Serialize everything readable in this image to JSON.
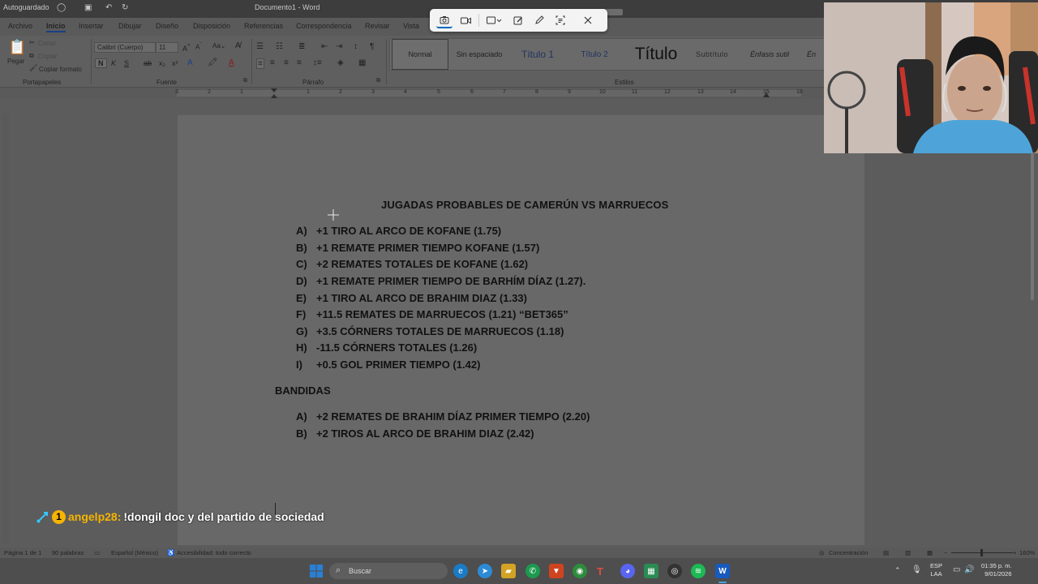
{
  "titlebar": {
    "autosave": "Autoguardado",
    "document_title": "Documento1 - Word"
  },
  "snip_toolbar": {
    "icons": [
      "camera-icon",
      "video-icon",
      "rect-select-icon",
      "edit-icon",
      "pen-icon",
      "text-extract-icon",
      "close-icon"
    ]
  },
  "menu": {
    "tabs": [
      "Archivo",
      "Inicio",
      "Insertar",
      "Dibujar",
      "Diseño",
      "Disposición",
      "Referencias",
      "Correspondencia",
      "Revisar",
      "Vista"
    ],
    "active_tab": "Inicio"
  },
  "ribbon": {
    "clipboard": {
      "paste_label": "Pegar",
      "cut_label": "Cortar",
      "copy_label": "Copiar",
      "format_painter_label": "Copiar formato",
      "group_label": "Portapapeles"
    },
    "font": {
      "font_name": "Calibri (Cuerpo)",
      "font_size": "11",
      "bold": "N",
      "italic": "K",
      "underline": "S",
      "group_label": "Fuente"
    },
    "paragraph": {
      "group_label": "Párrafo"
    },
    "styles": {
      "group_label": "Estilos",
      "items": [
        "Normal",
        "Sin espaciado",
        "Título 1",
        "Título 2",
        "Título",
        "Subtítulo",
        "Énfasis sutil",
        "Én"
      ],
      "selected": "Normal"
    }
  },
  "ruler": {
    "numbers": [
      "3",
      "2",
      "1",
      "1",
      "2",
      "3",
      "4",
      "5",
      "6",
      "7",
      "8",
      "9",
      "10",
      "11",
      "12",
      "13",
      "14",
      "15",
      "16",
      "18"
    ]
  },
  "document": {
    "title": "JUGADAS PROBABLES DE CAMERÚN VS MARRUECOS",
    "items": [
      {
        "marker": "A)",
        "text": "+1 TIRO AL ARCO DE KOFANE (1.75)"
      },
      {
        "marker": "B)",
        "text": "+1 REMATE PRIMER TIEMPO KOFANE (1.57)"
      },
      {
        "marker": "C)",
        "text": "+2 REMATES TOTALES DE KOFANE (1.62)"
      },
      {
        "marker": "D)",
        "text": "+1 REMATE PRIMER TIEMPO DE BARHÍM DÍAZ (1.27)."
      },
      {
        "marker": "E)",
        "text": "+1 TIRO AL ARCO DE BRAHIM DIAZ (1.33)"
      },
      {
        "marker": "F)",
        "text": "+11.5 REMATES DE MARRUECOS (1.21) “BET365”"
      },
      {
        "marker": "G)",
        "text": "+3.5 CÓRNERS TOTALES DE MARRUECOS (1.18)"
      },
      {
        "marker": "H)",
        "text": "-11.5 CÓRNERS TOTALES (1.26)"
      },
      {
        "marker": "I)",
        "text": "+0.5 GOL PRIMER TIEMPO (1.42)"
      }
    ],
    "section2_title": "BANDIDAS",
    "section2_items": [
      {
        "marker": "A)",
        "text": "+2 REMATES DE BRAHIM DÍAZ PRIMER TIEMPO (2.20)"
      },
      {
        "marker": "B)",
        "text": "+2 TIROS AL ARCO DE BRAHIM DIAZ (2.42)"
      }
    ]
  },
  "chat": {
    "badge": "1",
    "username": "angelp28:",
    "message": "!dongil doc y del partido de sociedad"
  },
  "statusbar": {
    "page": "Página 1 de 1",
    "words": "90 palabras",
    "language": "Español (México)",
    "accessibility": "Accesibilidad: todo correcto",
    "focus": "Concentración",
    "zoom": "160%"
  },
  "taskbar": {
    "search_placeholder": "Buscar",
    "lang_line1": "ESP",
    "lang_line2": "LAA",
    "time": "01:35 p. m.",
    "date": "9/01/2026"
  },
  "colors": {
    "chat_username": "#f5b400",
    "chat_badge": "#f5b400",
    "page_background": "#686868",
    "word_blue": "#185abd"
  }
}
